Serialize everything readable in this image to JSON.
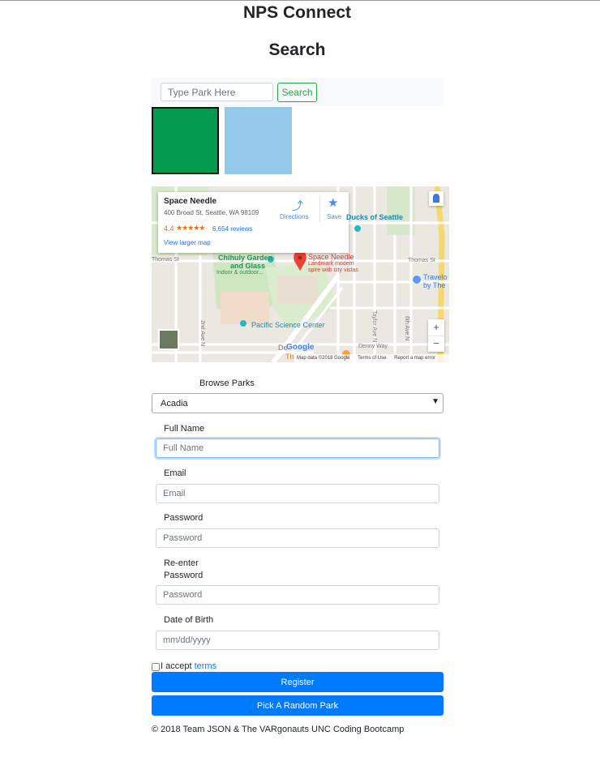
{
  "header": {
    "title": "NPS Connect",
    "subtitle": "Search"
  },
  "search": {
    "placeholder": "Type Park Here",
    "button_label": "Search"
  },
  "swatches": {
    "left_color": "#039a4f",
    "right_color": "#95c9e9"
  },
  "map": {
    "place_name": "Space Needle",
    "address": "400 Broad St, Seattle, WA 98109",
    "rating": "4.4",
    "stars": "★★★★★",
    "reviews": "6,654 reviews",
    "larger_map": "View larger map",
    "directions_label": "Directions",
    "save_label": "Save",
    "labels": {
      "ducks": "Ducks of Seattle",
      "chihuly_1": "Chihuly Garden",
      "chihuly_2": "and Glass",
      "chihuly_3": "Indoor & outdoor...",
      "needle_1": "Space Needle",
      "needle_2": "Landmark modern",
      "needle_3": "spire with city vistas",
      "thomas_w": "Thomas St",
      "thomas_e": "Thomas St",
      "travelo_1": "Travelo",
      "travelo_2": "by The",
      "pacific": "Pacific Science Center",
      "second_ave": "2nd Ave N",
      "taylor_ave": "Taylor Ave N",
      "sixth_ave": "6th Ave N",
      "denny_way": "Denny Way",
      "de_fragment": "De",
      "th_fragment": "Th",
      "google": "Google"
    },
    "footer": {
      "map_data": "Map data ©2018 Google",
      "terms": "Terms of Use",
      "report": "Report a map error"
    },
    "zoom_in": "+",
    "zoom_out": "−"
  },
  "browse": {
    "label": "Browse Parks",
    "selected": "Acadia"
  },
  "form": {
    "full_name_label": "Full Name",
    "full_name_placeholder": "Full Name",
    "email_label": "Email",
    "email_placeholder": "Email",
    "password_label": "Password",
    "password_placeholder": "Password",
    "reenter_label_1": "Re-enter",
    "reenter_label_2": "Password",
    "reenter_placeholder": "Password",
    "dob_label": "Date of Birth",
    "dob_placeholder": "mm/dd/yyyy",
    "accept_text": "I accept",
    "terms_link": "terms",
    "register_label": "Register",
    "random_label": "Pick A Random Park"
  },
  "footer": {
    "copyright": "© 2018 Team JSON & The VARgonauts UNC Coding Bootcamp"
  }
}
